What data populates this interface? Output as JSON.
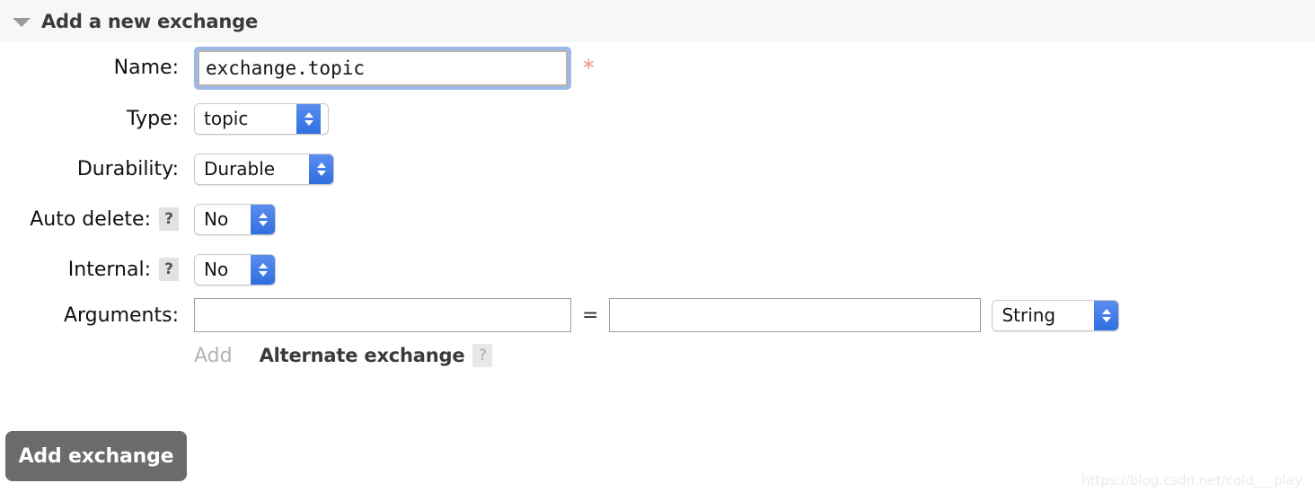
{
  "section": {
    "title": "Add a new exchange",
    "disclosure_state": "expanded"
  },
  "form": {
    "name": {
      "label": "Name:",
      "value": "exchange.topic",
      "placeholder": "",
      "required_marker": "*",
      "focused": true
    },
    "type": {
      "label": "Type:",
      "value": "topic"
    },
    "durability": {
      "label": "Durability:",
      "value": "Durable"
    },
    "auto_delete": {
      "label": "Auto delete:",
      "help": "?",
      "value": "No"
    },
    "internal": {
      "label": "Internal:",
      "help": "?",
      "value": "No"
    },
    "arguments": {
      "label": "Arguments:",
      "key_value": "",
      "key_placeholder": "",
      "equals": "=",
      "value_value": "",
      "value_placeholder": "",
      "type_value": "String"
    },
    "add_row": {
      "add_label": "Add",
      "alternate_exchange_label": "Alternate exchange",
      "help": "?"
    }
  },
  "submit": {
    "label": "Add exchange"
  },
  "watermark": {
    "text": "https://blog.csdn.net/cold___play"
  },
  "colors": {
    "header_bg": "#f7f7f7",
    "page_bg": "#ffffff",
    "focus_ring": "#9bbaea",
    "stepper_blue": "#3b78e7",
    "required_star": "#f08a82",
    "submit_bg": "#6b6b6b",
    "help_badge_bg": "#e2e2e2",
    "add_link": "#b5b5b5",
    "watermark": "#ebebeb"
  }
}
